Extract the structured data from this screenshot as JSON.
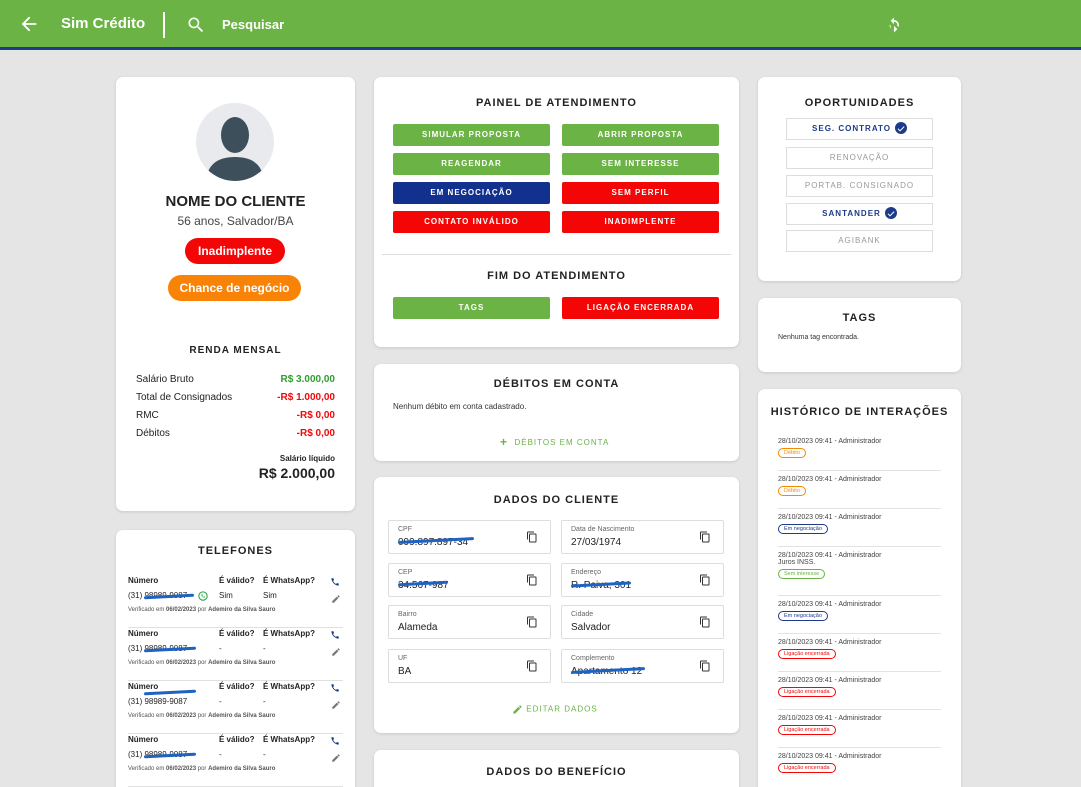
{
  "topbar": {
    "title": "Sim Crédito",
    "search_label": "Pesquisar"
  },
  "profile": {
    "name": "NOME DO CLIENTE",
    "subtitle": "56 anos, Salvador/BA",
    "status_badge": "Inadimplente",
    "chance_badge": "Chance de negócio",
    "renda_title": "RENDA MENSAL",
    "renda": [
      {
        "label": "Salário Bruto",
        "value": "R$ 3.000,00",
        "color": "#2e9e2e"
      },
      {
        "label": "Total de Consignados",
        "value": "-R$ 1.000,00",
        "color": "#f40606"
      },
      {
        "label": "RMC",
        "value": "-R$ 0,00",
        "color": "#f40606"
      },
      {
        "label": "Débitos",
        "value": "-R$ 0,00",
        "color": "#f40606"
      }
    ],
    "liquido_label": "Salário líquido",
    "liquido_value": "R$ 2.000,00"
  },
  "telefones": {
    "title": "TELEFONES",
    "headers": {
      "numero": "Número",
      "valido": "É válido?",
      "whatsapp": "É WhatsApp?"
    },
    "verified_label": "Verificado em",
    "by_label": "por",
    "items": [
      {
        "numero": "(31) 98989-9087",
        "valido": "Sim",
        "whatsapp": "Sim",
        "date": "06/02/2023",
        "by": "Ademiro da Silva Sauro"
      },
      {
        "numero": "(31) 98989-9087",
        "valido": "-",
        "whatsapp": "-",
        "date": "06/02/2023",
        "by": "Ademiro da Silva Sauro"
      },
      {
        "numero": "(31) 98989-9087",
        "valido": "-",
        "whatsapp": "-",
        "date": "06/02/2023",
        "by": "Ademiro da Silva Sauro"
      },
      {
        "numero": "(31) 98989-9087",
        "valido": "-",
        "whatsapp": "-",
        "date": "06/02/2023",
        "by": "Ademiro da Silva Sauro"
      }
    ]
  },
  "painel": {
    "title": "PAINEL DE ATENDIMENTO",
    "simular": "SIMULAR PROPOSTA",
    "abrir": "ABRIR PROPOSTA",
    "reagendar": "REAGENDAR",
    "sem_interesse": "SEM INTERESSE",
    "em_negociacao": "EM NEGOCIAÇÃO",
    "sem_perfil": "SEM PERFIL",
    "contato_invalido": "CONTATO INVÁLIDO",
    "inadimplente": "INADIMPLENTE",
    "fim_title": "FIM DO ATENDIMENTO",
    "tags": "TAGS",
    "ligacao_encerrada": "LIGAÇÃO ENCERRADA"
  },
  "debitos": {
    "title": "DÉBITOS EM CONTA",
    "empty": "Nenhum débito em conta cadastrado.",
    "add_label": "DÉBITOS EM CONTA"
  },
  "dados_cliente": {
    "title": "DADOS DO CLIENTE",
    "fields": [
      {
        "label": "CPF",
        "value": "099.897.897-34"
      },
      {
        "label": "Data de Nascimento",
        "value": "27/03/1974"
      },
      {
        "label": "CEP",
        "value": "34.567-987"
      },
      {
        "label": "Endereço",
        "value": "R. Paiva, 301"
      },
      {
        "label": "Bairro",
        "value": "Alameda"
      },
      {
        "label": "Cidade",
        "value": "Salvador"
      },
      {
        "label": "UF",
        "value": "BA"
      },
      {
        "label": "Complemento",
        "value": "Apartamento 12"
      }
    ],
    "edit_label": "EDITAR DADOS"
  },
  "dados_beneficio": {
    "title": "DADOS DO BENEFÍCIO"
  },
  "oportunidades": {
    "title": "OPORTUNIDADES",
    "items": [
      "SEG. CONTRATO",
      "RENOVAÇÃO",
      "PORTAB. CONSIGNADO",
      "SANTANDER",
      "AGIBANK"
    ]
  },
  "tags_card": {
    "title": "TAGS",
    "empty": "Nenhuma tag encontrada."
  },
  "historico": {
    "title": "HISTÓRICO DE INTERAÇÕES",
    "items": [
      {
        "meta": "28/10/2023 09:41 - Administrador",
        "note": "",
        "tag": "Débito",
        "color": "#f08a00"
      },
      {
        "meta": "28/10/2023 09:41 - Administrador",
        "note": "",
        "tag": "Débito",
        "color": "#f08a00"
      },
      {
        "meta": "28/10/2023 09:41 - Administrador",
        "note": "",
        "tag": "Em negociação",
        "color": "#1e3a8a"
      },
      {
        "meta": "28/10/2023 09:41 - Administrador",
        "note": "Juros INSS.",
        "tag": "Sem interesse",
        "color": "#6ab344"
      },
      {
        "meta": "28/10/2023 09:41 - Administrador",
        "note": "",
        "tag": "Em negociação",
        "color": "#1e3a8a"
      },
      {
        "meta": "28/10/2023 09:41 - Administrador",
        "note": "",
        "tag": "Ligação encerrada",
        "color": "#f40606"
      },
      {
        "meta": "28/10/2023 09:41 - Administrador",
        "note": "",
        "tag": "Ligação encerrada",
        "color": "#f40606"
      },
      {
        "meta": "28/10/2023 09:41 - Administrador",
        "note": "",
        "tag": "Ligação encerrada",
        "color": "#f40606"
      },
      {
        "meta": "28/10/2023 09:41 - Administrador",
        "note": "",
        "tag": "Ligação encerrada",
        "color": "#f40606"
      }
    ]
  }
}
